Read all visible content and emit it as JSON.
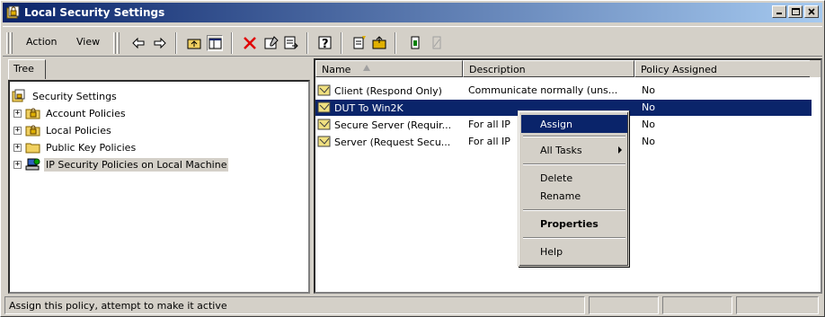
{
  "window": {
    "title": "Local Security Settings",
    "titlebar_colors": [
      "#0a246a",
      "#a6caf0"
    ]
  },
  "menu": {
    "action": "Action",
    "view": "View"
  },
  "toolbar": {
    "icons": [
      "back-arrow-icon",
      "forward-arrow-icon",
      "up-folder-icon",
      "show-hide-tree-icon",
      "delete-icon",
      "properties-icon",
      "export-list-icon",
      "help-icon",
      "create-policy-icon",
      "add-policy-icon",
      "assign-icon",
      "unassign-icon"
    ]
  },
  "tree": {
    "tab": "Tree",
    "items": [
      {
        "label": "Security Settings",
        "icon": "security-settings-icon"
      },
      {
        "label": "Account Policies",
        "icon": "folder-lock-icon"
      },
      {
        "label": "Local Policies",
        "icon": "folder-lock-icon"
      },
      {
        "label": "Public Key Policies",
        "icon": "folder-icon"
      },
      {
        "label": "IP Security Policies on Local Machine",
        "icon": "ipsec-icon"
      }
    ]
  },
  "list": {
    "columns": [
      "Name",
      "Description",
      "Policy Assigned"
    ],
    "rows": [
      {
        "name": "Client (Respond Only)",
        "description": "Communicate normally (uns...",
        "assigned": "No"
      },
      {
        "name": "DUT To Win2K",
        "description": "",
        "assigned": "No"
      },
      {
        "name": "Secure Server (Requir...",
        "description": "For all IP",
        "assigned": "No"
      },
      {
        "name": "Server (Request Secu...",
        "description": "For all IP",
        "assigned": "No"
      }
    ]
  },
  "context_menu": {
    "assign": "Assign",
    "all_tasks": "All Tasks",
    "delete": "Delete",
    "rename": "Rename",
    "properties": "Properties",
    "help": "Help"
  },
  "status": {
    "text": "Assign this policy, attempt to make it active"
  }
}
